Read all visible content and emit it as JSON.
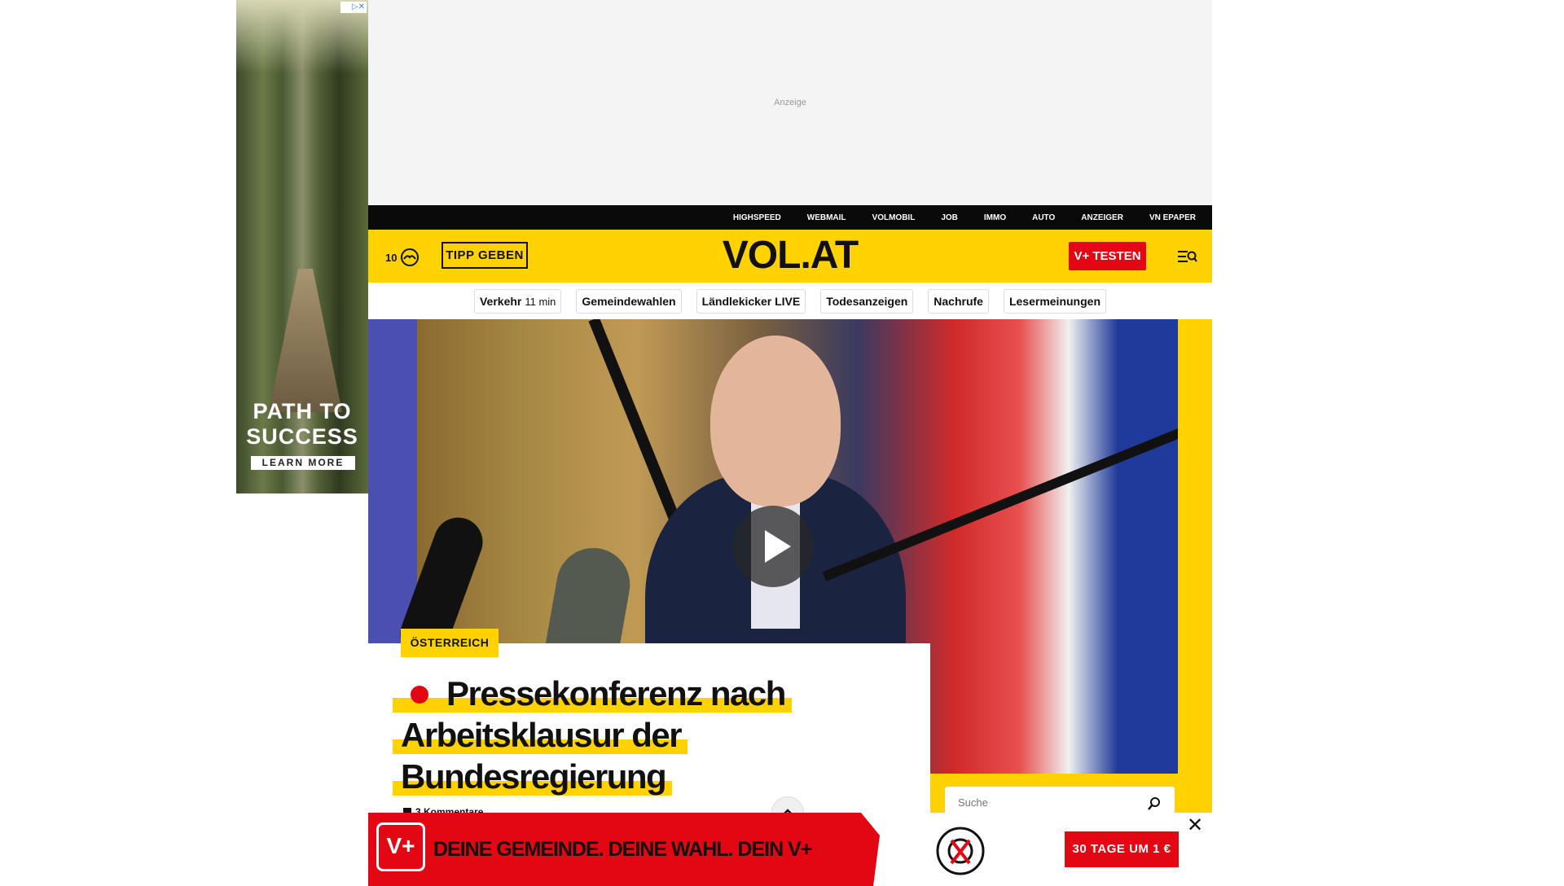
{
  "skyscraper_ad": {
    "adchoices_label": "▷✕",
    "title": "PATH TO SUCCESS",
    "cta": "LEARN MORE"
  },
  "top_ad": {
    "label": "Anzeige"
  },
  "top_nav": {
    "items": [
      "HIGHSPEED",
      "WEBMAIL",
      "VOLMOBIL",
      "JOB",
      "IMMO",
      "AUTO",
      "ANZEIGER",
      "VN EPAPER"
    ]
  },
  "header": {
    "temperature": "10",
    "weather_icon": "cloudy-weather-icon",
    "tip_button": "TIPP GEBEN",
    "logo": "VOL.AT",
    "vplus_button": "V+ TESTEN",
    "menu_icon": "menu-search-icon"
  },
  "quick_links": [
    {
      "label": "Verkehr",
      "sub": "11 min"
    },
    {
      "label": "Gemeindewahlen",
      "sub": ""
    },
    {
      "label": "Ländlekicker LIVE",
      "sub": ""
    },
    {
      "label": "Todesanzeigen",
      "sub": ""
    },
    {
      "label": "Nachrufe",
      "sub": ""
    },
    {
      "label": "Lesermeinungen",
      "sub": ""
    }
  ],
  "hero": {
    "category": "ÖSTERREICH",
    "headline": "Pressekonferenz nach Arbeitsklausur der Bundesregierung",
    "comments": "3 Kommentare",
    "is_live": true
  },
  "sidebar": {
    "search_placeholder": "Suche"
  },
  "bottom_banner": {
    "logo": "V+",
    "slogan": "DEINE GEMEINDE. DEINE WAHL. DEIN V+",
    "cta": "30 TAGE UM 1 €",
    "close_label": "✕"
  },
  "colors": {
    "brand_yellow": "#ffd200",
    "brand_red": "#e30613",
    "nav_black": "#0a0a0a"
  }
}
